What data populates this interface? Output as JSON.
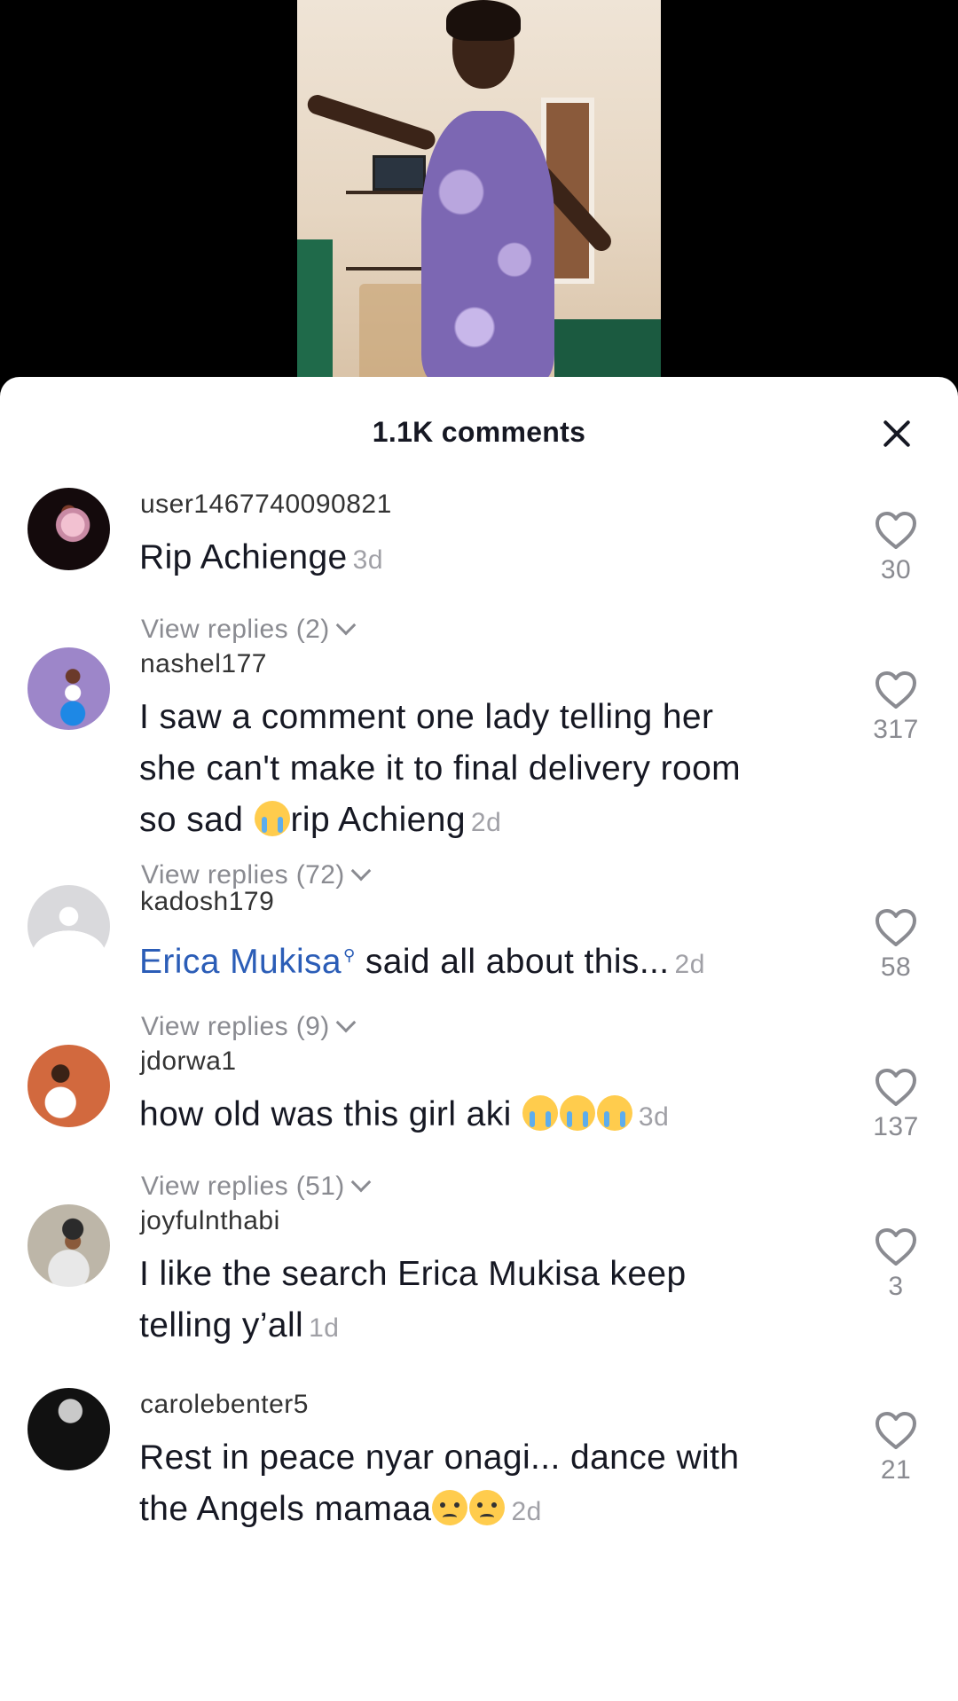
{
  "sheet": {
    "title": "1.1K comments",
    "close_icon": "close-icon"
  },
  "comments": [
    {
      "username": "user1467740090821",
      "text": "Rip Achienge",
      "time": "3d",
      "likes": "30",
      "replies": "View replies (2)"
    },
    {
      "username": "nashel177",
      "text_line1": "I saw a comment one lady telling her",
      "text_line2": "she can't make it to final delivery room",
      "text_line3_pre": "so sad ",
      "text_line3_post": "rip Achieng",
      "time": "2d",
      "likes": "317",
      "replies": "View replies (72)"
    },
    {
      "username": "kadosh179",
      "mention": "Erica Mukisa",
      "text": " said all about this...",
      "time": "2d",
      "likes": "58",
      "replies": "View replies (9)"
    },
    {
      "username": "jdorwa1",
      "text": "how old was this girl aki ",
      "time": "3d",
      "likes": "137",
      "replies": "View replies (51)"
    },
    {
      "username": "joyfulnthabi",
      "text_line1": "I like the search Erica Mukisa keep",
      "text_line2": "telling y’all",
      "time": "1d",
      "likes": "3"
    },
    {
      "username": "carolebenter5",
      "text_line1": "Rest in peace nyar onagi... dance with",
      "text_line2": "the Angels mamaa",
      "time": "2d",
      "likes": "21"
    }
  ],
  "colors": {
    "mention": "#2b5db7",
    "text": "#161823",
    "muted": "#8a8b91"
  }
}
